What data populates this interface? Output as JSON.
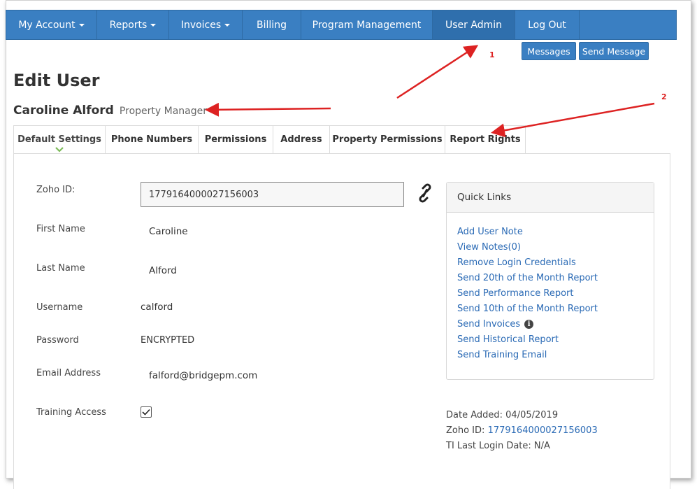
{
  "nav": {
    "items": [
      {
        "label": "My Account",
        "dropdown": true
      },
      {
        "label": "Reports",
        "dropdown": true
      },
      {
        "label": "Invoices",
        "dropdown": true
      },
      {
        "label": "Billing",
        "dropdown": false
      },
      {
        "label": "Program Management",
        "dropdown": false
      },
      {
        "label": "User Admin",
        "dropdown": false
      },
      {
        "label": "Log Out",
        "dropdown": false
      }
    ]
  },
  "toolbar": {
    "messages_label": "Messages",
    "send_message_label": "Send Message"
  },
  "page": {
    "title": "Edit User",
    "user_name": "Caroline Alford",
    "user_role": "Property Manager"
  },
  "tabs": [
    {
      "label": "Default Settings",
      "active": true
    },
    {
      "label": "Phone Numbers",
      "active": false
    },
    {
      "label": "Permissions",
      "active": false
    },
    {
      "label": "Address",
      "active": false
    },
    {
      "label": "Property Permissions",
      "active": false
    },
    {
      "label": "Report Rights",
      "active": false
    }
  ],
  "form": {
    "zoho_label": "Zoho ID:",
    "zoho_value": "1779164000027156003",
    "first_name_label": "First Name",
    "first_name_value": "Caroline",
    "last_name_label": "Last Name",
    "last_name_value": "Alford",
    "username_label": "Username",
    "username_value": "calford",
    "password_label": "Password",
    "password_value": "ENCRYPTED",
    "email_label": "Email Address",
    "email_value": "falford@bridgepm.com",
    "training_label": "Training Access",
    "training_checked": true
  },
  "quick_links": {
    "title": "Quick Links",
    "items": [
      "Add User Note",
      "View Notes(0)",
      "Remove Login Credentials",
      "Send 20th of the Month Report",
      "Send Performance Report",
      "Send 10th of the Month Report",
      "Send Invoices",
      "Send Historical Report",
      "Send Training Email"
    ]
  },
  "meta": {
    "date_added_label": "Date Added:",
    "date_added_value": "04/05/2019",
    "zoho_label": "Zoho ID:",
    "zoho_value": "1779164000027156003",
    "ti_login_label": "TI Last Login Date:",
    "ti_login_value": "N/A"
  },
  "annotations": {
    "one": "1",
    "two": "2"
  },
  "colors": {
    "nav_bg": "#3a7fc2",
    "link": "#2a6ab5",
    "annotation": "#dd2222"
  }
}
